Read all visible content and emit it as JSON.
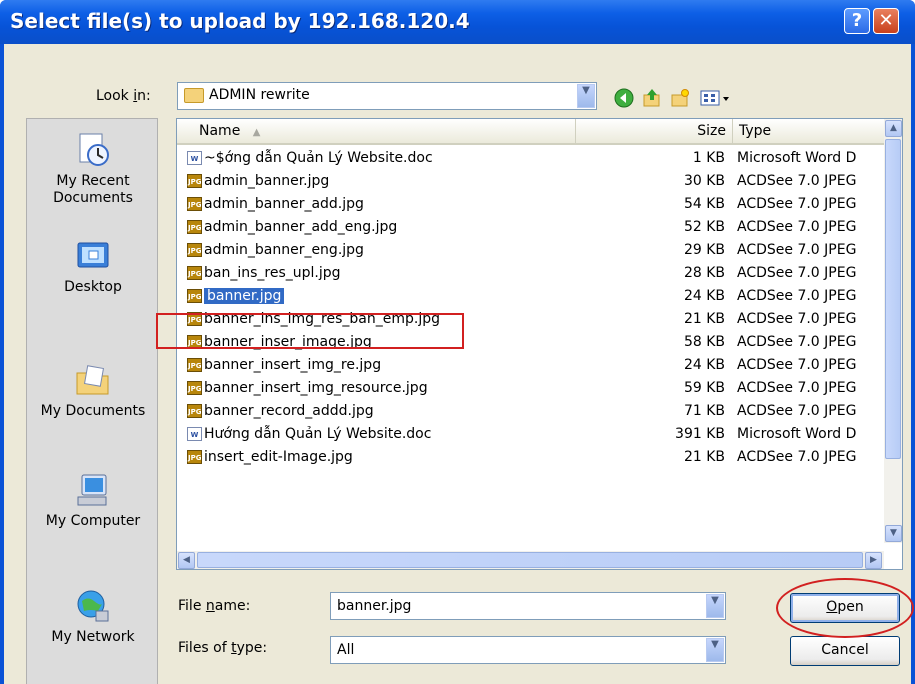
{
  "window": {
    "title": "Select file(s) to upload by 192.168.120.4",
    "help_label": "?",
    "close_label": "✕"
  },
  "lookin": {
    "label": "Look in:",
    "label_u": "i",
    "label_pre": "Look ",
    "label_post": "n:",
    "value": "ADMIN rewrite"
  },
  "places": [
    {
      "label": "My Recent Documents",
      "icon": "recent-documents-icon"
    },
    {
      "label": "Desktop",
      "icon": "desktop-icon"
    },
    {
      "label": "My Documents",
      "icon": "my-documents-icon"
    },
    {
      "label": "My Computer",
      "icon": "my-computer-icon"
    },
    {
      "label": "My Network",
      "icon": "my-network-icon"
    }
  ],
  "columns": {
    "name": "Name",
    "size": "Size",
    "type": "Type"
  },
  "files": [
    {
      "name": "~$ớng dẫn Quản Lý Website.doc",
      "size": "1 KB",
      "type": "Microsoft Word D",
      "kind": "doc"
    },
    {
      "name": "admin_banner.jpg",
      "size": "30 KB",
      "type": "ACDSee 7.0 JPEG",
      "kind": "jpg"
    },
    {
      "name": "admin_banner_add.jpg",
      "size": "54 KB",
      "type": "ACDSee 7.0 JPEG",
      "kind": "jpg"
    },
    {
      "name": "admin_banner_add_eng.jpg",
      "size": "52 KB",
      "type": "ACDSee 7.0 JPEG",
      "kind": "jpg"
    },
    {
      "name": "admin_banner_eng.jpg",
      "size": "29 KB",
      "type": "ACDSee 7.0 JPEG",
      "kind": "jpg"
    },
    {
      "name": "ban_ins_res_upl.jpg",
      "size": "28 KB",
      "type": "ACDSee 7.0 JPEG",
      "kind": "jpg"
    },
    {
      "name": "banner.jpg",
      "size": "24 KB",
      "type": "ACDSee 7.0 JPEG",
      "kind": "jpg",
      "selected": true
    },
    {
      "name": "banner_ins_img_res_ban_emp.jpg",
      "size": "21 KB",
      "type": "ACDSee 7.0 JPEG",
      "kind": "jpg"
    },
    {
      "name": "banner_inser_image.jpg",
      "size": "58 KB",
      "type": "ACDSee 7.0 JPEG",
      "kind": "jpg"
    },
    {
      "name": "banner_insert_img_re.jpg",
      "size": "24 KB",
      "type": "ACDSee 7.0 JPEG",
      "kind": "jpg"
    },
    {
      "name": "banner_insert_img_resource.jpg",
      "size": "59 KB",
      "type": "ACDSee 7.0 JPEG",
      "kind": "jpg"
    },
    {
      "name": "banner_record_addd.jpg",
      "size": "71 KB",
      "type": "ACDSee 7.0 JPEG",
      "kind": "jpg"
    },
    {
      "name": "Hướng dẫn Quản Lý Website.doc",
      "size": "391 KB",
      "type": "Microsoft Word D",
      "kind": "doc"
    },
    {
      "name": "insert_edit-Image.jpg",
      "size": "21 KB",
      "type": "ACDSee 7.0 JPEG",
      "kind": "jpg"
    }
  ],
  "filename": {
    "label_pre": "File ",
    "label_u": "n",
    "label_post": "ame:",
    "value": "banner.jpg"
  },
  "filetype": {
    "label_pre": "Files of ",
    "label_u": "t",
    "label_post": "ype:",
    "value": "All"
  },
  "buttons": {
    "open_u": "O",
    "open_rest": "pen",
    "cancel": "Cancel"
  },
  "colors": {
    "accent": "#0a52d6",
    "selection": "#316ac5",
    "highlight": "#d22020"
  }
}
